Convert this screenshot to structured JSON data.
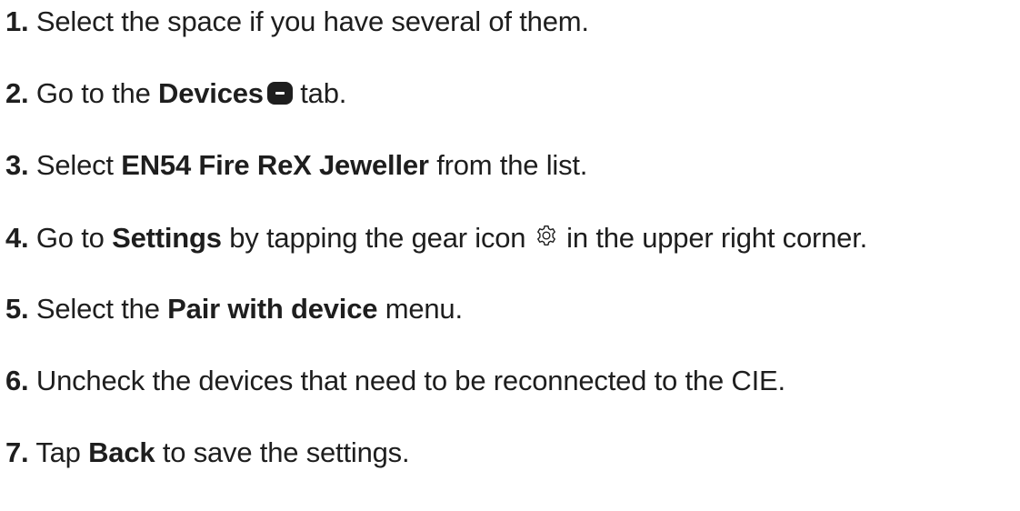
{
  "steps": [
    {
      "number": "1.",
      "text": " Select the space if you have several of them."
    },
    {
      "number": "2.",
      "pre": " Go to the ",
      "bold": "Devices",
      "icon": "devices-tab-icon",
      "post": " tab."
    },
    {
      "number": "3.",
      "pre": " Select ",
      "bold": "EN54 Fire ReX Jeweller",
      "post": " from the list."
    },
    {
      "number": "4.",
      "pre": " Go to ",
      "bold": "Settings",
      "mid": " by tapping the gear icon ",
      "icon": "gear-icon",
      "post": " in the upper right corner."
    },
    {
      "number": "5.",
      "pre": " Select the ",
      "bold": "Pair with device",
      "post": " menu."
    },
    {
      "number": "6.",
      "text": " Uncheck the devices that need to be reconnected to the CIE."
    },
    {
      "number": "7.",
      "pre": " Tap ",
      "bold": "Back",
      "post": " to save the settings."
    }
  ],
  "colors": {
    "text": "#1e1e1e",
    "background": "#ffffff"
  }
}
